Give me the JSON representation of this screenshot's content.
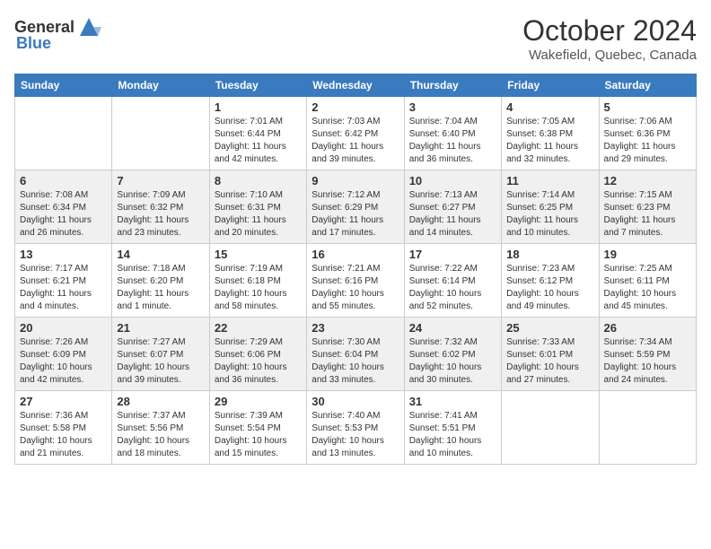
{
  "header": {
    "logo_general": "General",
    "logo_blue": "Blue",
    "month": "October 2024",
    "location": "Wakefield, Quebec, Canada"
  },
  "days_of_week": [
    "Sunday",
    "Monday",
    "Tuesday",
    "Wednesday",
    "Thursday",
    "Friday",
    "Saturday"
  ],
  "weeks": [
    [
      {
        "day": "",
        "info": ""
      },
      {
        "day": "",
        "info": ""
      },
      {
        "day": "1",
        "info": "Sunrise: 7:01 AM\nSunset: 6:44 PM\nDaylight: 11 hours and 42 minutes."
      },
      {
        "day": "2",
        "info": "Sunrise: 7:03 AM\nSunset: 6:42 PM\nDaylight: 11 hours and 39 minutes."
      },
      {
        "day": "3",
        "info": "Sunrise: 7:04 AM\nSunset: 6:40 PM\nDaylight: 11 hours and 36 minutes."
      },
      {
        "day": "4",
        "info": "Sunrise: 7:05 AM\nSunset: 6:38 PM\nDaylight: 11 hours and 32 minutes."
      },
      {
        "day": "5",
        "info": "Sunrise: 7:06 AM\nSunset: 6:36 PM\nDaylight: 11 hours and 29 minutes."
      }
    ],
    [
      {
        "day": "6",
        "info": "Sunrise: 7:08 AM\nSunset: 6:34 PM\nDaylight: 11 hours and 26 minutes."
      },
      {
        "day": "7",
        "info": "Sunrise: 7:09 AM\nSunset: 6:32 PM\nDaylight: 11 hours and 23 minutes."
      },
      {
        "day": "8",
        "info": "Sunrise: 7:10 AM\nSunset: 6:31 PM\nDaylight: 11 hours and 20 minutes."
      },
      {
        "day": "9",
        "info": "Sunrise: 7:12 AM\nSunset: 6:29 PM\nDaylight: 11 hours and 17 minutes."
      },
      {
        "day": "10",
        "info": "Sunrise: 7:13 AM\nSunset: 6:27 PM\nDaylight: 11 hours and 14 minutes."
      },
      {
        "day": "11",
        "info": "Sunrise: 7:14 AM\nSunset: 6:25 PM\nDaylight: 11 hours and 10 minutes."
      },
      {
        "day": "12",
        "info": "Sunrise: 7:15 AM\nSunset: 6:23 PM\nDaylight: 11 hours and 7 minutes."
      }
    ],
    [
      {
        "day": "13",
        "info": "Sunrise: 7:17 AM\nSunset: 6:21 PM\nDaylight: 11 hours and 4 minutes."
      },
      {
        "day": "14",
        "info": "Sunrise: 7:18 AM\nSunset: 6:20 PM\nDaylight: 11 hours and 1 minute."
      },
      {
        "day": "15",
        "info": "Sunrise: 7:19 AM\nSunset: 6:18 PM\nDaylight: 10 hours and 58 minutes."
      },
      {
        "day": "16",
        "info": "Sunrise: 7:21 AM\nSunset: 6:16 PM\nDaylight: 10 hours and 55 minutes."
      },
      {
        "day": "17",
        "info": "Sunrise: 7:22 AM\nSunset: 6:14 PM\nDaylight: 10 hours and 52 minutes."
      },
      {
        "day": "18",
        "info": "Sunrise: 7:23 AM\nSunset: 6:12 PM\nDaylight: 10 hours and 49 minutes."
      },
      {
        "day": "19",
        "info": "Sunrise: 7:25 AM\nSunset: 6:11 PM\nDaylight: 10 hours and 45 minutes."
      }
    ],
    [
      {
        "day": "20",
        "info": "Sunrise: 7:26 AM\nSunset: 6:09 PM\nDaylight: 10 hours and 42 minutes."
      },
      {
        "day": "21",
        "info": "Sunrise: 7:27 AM\nSunset: 6:07 PM\nDaylight: 10 hours and 39 minutes."
      },
      {
        "day": "22",
        "info": "Sunrise: 7:29 AM\nSunset: 6:06 PM\nDaylight: 10 hours and 36 minutes."
      },
      {
        "day": "23",
        "info": "Sunrise: 7:30 AM\nSunset: 6:04 PM\nDaylight: 10 hours and 33 minutes."
      },
      {
        "day": "24",
        "info": "Sunrise: 7:32 AM\nSunset: 6:02 PM\nDaylight: 10 hours and 30 minutes."
      },
      {
        "day": "25",
        "info": "Sunrise: 7:33 AM\nSunset: 6:01 PM\nDaylight: 10 hours and 27 minutes."
      },
      {
        "day": "26",
        "info": "Sunrise: 7:34 AM\nSunset: 5:59 PM\nDaylight: 10 hours and 24 minutes."
      }
    ],
    [
      {
        "day": "27",
        "info": "Sunrise: 7:36 AM\nSunset: 5:58 PM\nDaylight: 10 hours and 21 minutes."
      },
      {
        "day": "28",
        "info": "Sunrise: 7:37 AM\nSunset: 5:56 PM\nDaylight: 10 hours and 18 minutes."
      },
      {
        "day": "29",
        "info": "Sunrise: 7:39 AM\nSunset: 5:54 PM\nDaylight: 10 hours and 15 minutes."
      },
      {
        "day": "30",
        "info": "Sunrise: 7:40 AM\nSunset: 5:53 PM\nDaylight: 10 hours and 13 minutes."
      },
      {
        "day": "31",
        "info": "Sunrise: 7:41 AM\nSunset: 5:51 PM\nDaylight: 10 hours and 10 minutes."
      },
      {
        "day": "",
        "info": ""
      },
      {
        "day": "",
        "info": ""
      }
    ]
  ]
}
